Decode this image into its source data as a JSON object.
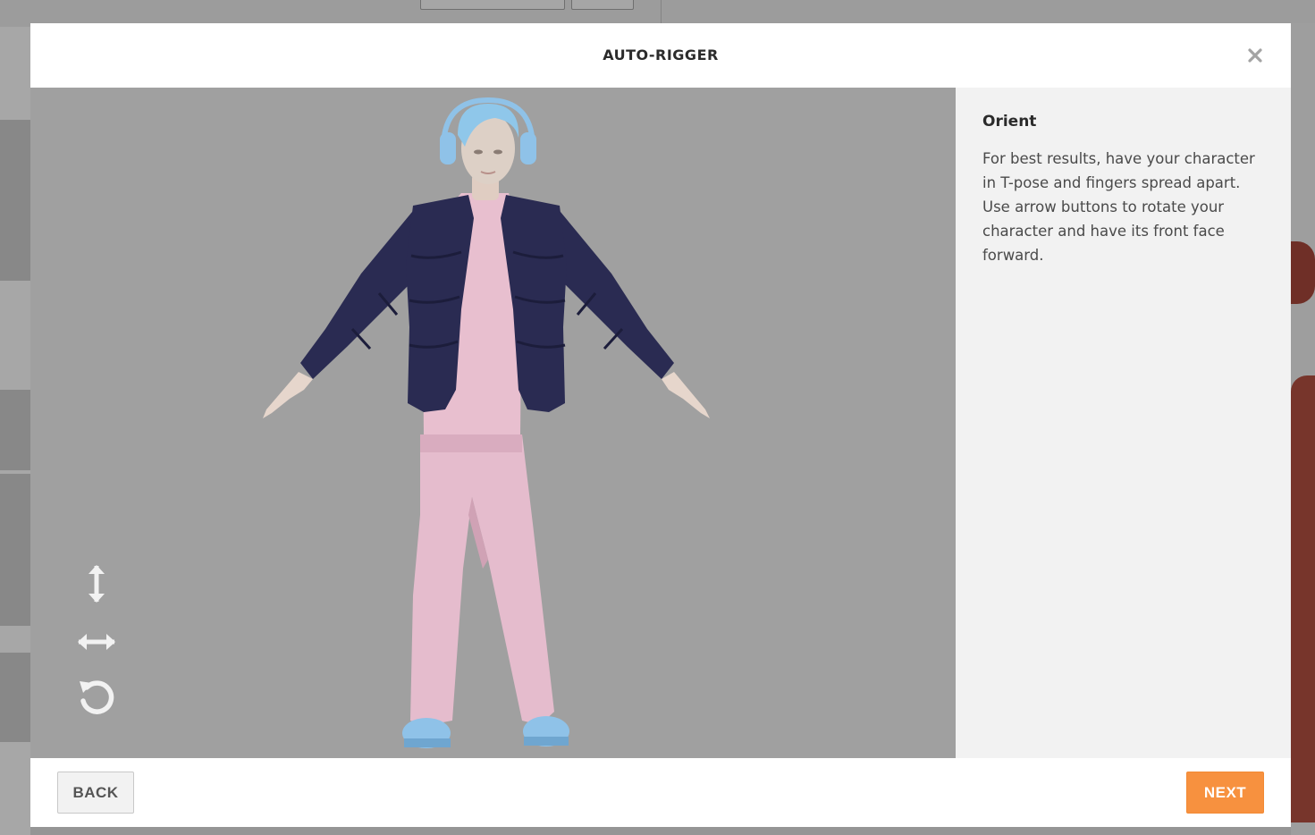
{
  "modal": {
    "title": "AUTO-RIGGER",
    "close_icon": "close-icon"
  },
  "viewport": {
    "controls": [
      {
        "name": "rotate-vertical",
        "icon": "vertical-arrows-icon"
      },
      {
        "name": "rotate-horizontal",
        "icon": "horizontal-arrows-icon"
      },
      {
        "name": "reset-rotation",
        "icon": "undo-rotate-icon"
      }
    ],
    "colors": {
      "background": "#a0a0a0",
      "jacket": "#2a2b52",
      "pants": "#e8bfcf",
      "hair": "#8fc7ea",
      "skin": "#e6d6cc"
    }
  },
  "panel": {
    "heading": "Orient",
    "text": "For best results, have your character in T-pose and fingers spread apart. Use arrow buttons to rotate your character and have its front face forward."
  },
  "footer": {
    "back_label": "BACK",
    "next_label": "NEXT",
    "accent": "#f7913f"
  }
}
